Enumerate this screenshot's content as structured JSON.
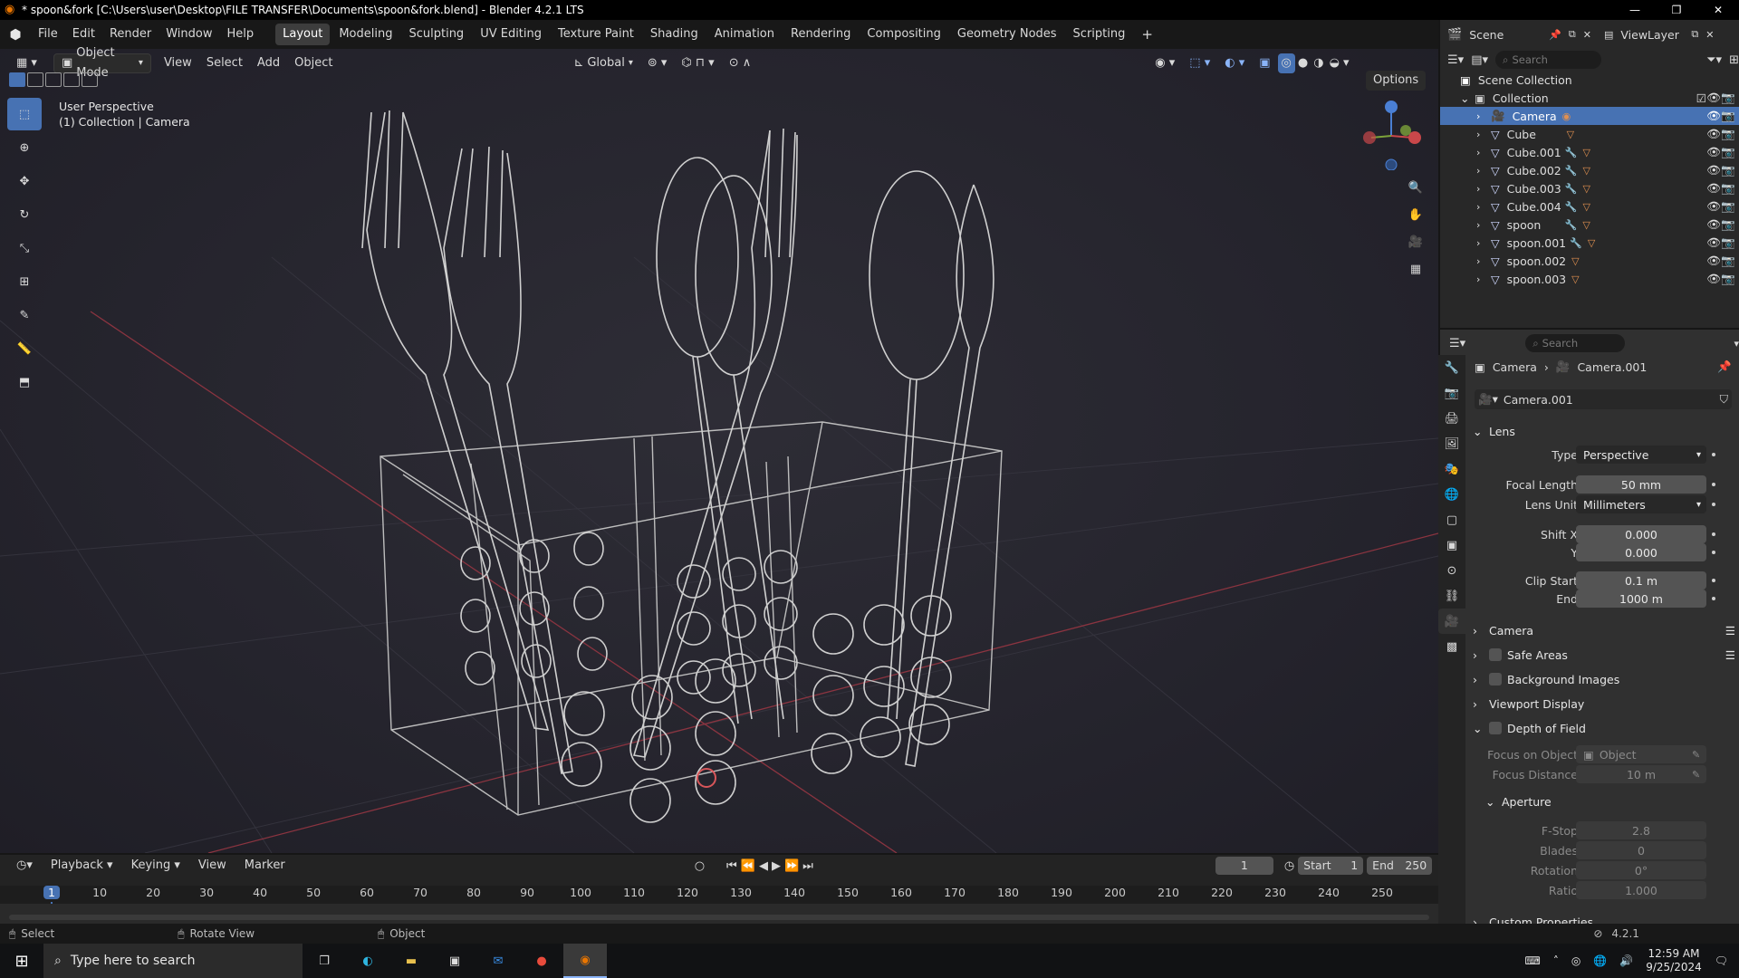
{
  "window": {
    "title": "* spoon&fork [C:\\Users\\user\\Desktop\\FILE TRANSFER\\Documents\\spoon&fork.blend] - Blender 4.2.1 LTS",
    "controls": [
      "—",
      "❐",
      "✕"
    ]
  },
  "menu": [
    "File",
    "Edit",
    "Render",
    "Window",
    "Help"
  ],
  "workspaces": [
    "Layout",
    "Modeling",
    "Sculpting",
    "UV Editing",
    "Texture Paint",
    "Shading",
    "Animation",
    "Rendering",
    "Compositing",
    "Geometry Nodes",
    "Scripting"
  ],
  "active_workspace": "Layout",
  "scene": {
    "label": "Scene",
    "view_layer": "ViewLayer"
  },
  "viewport_header": {
    "mode": "Object Mode",
    "menus": [
      "View",
      "Select",
      "Add",
      "Object"
    ],
    "orientation": "Global",
    "options": "Options"
  },
  "viewport_info": {
    "line1": "User Perspective",
    "line2": "(1) Collection | Camera"
  },
  "gizmo": {
    "x": "X",
    "y": "Y",
    "z": "Z"
  },
  "outliner": {
    "search_placeholder": "Search",
    "scene_collection": "Scene Collection",
    "collection": "Collection",
    "items": [
      {
        "name": "Camera",
        "selected": true
      },
      {
        "name": "Cube",
        "selected": false
      },
      {
        "name": "Cube.001",
        "selected": false
      },
      {
        "name": "Cube.002",
        "selected": false
      },
      {
        "name": "Cube.003",
        "selected": false
      },
      {
        "name": "Cube.004",
        "selected": false
      },
      {
        "name": "spoon",
        "selected": false
      },
      {
        "name": "spoon.001",
        "selected": false
      },
      {
        "name": "spoon.002",
        "selected": false
      },
      {
        "name": "spoon.003",
        "selected": false
      }
    ]
  },
  "properties": {
    "search_placeholder": "Search",
    "breadcrumb_object": "Camera",
    "breadcrumb_data": "Camera.001",
    "datablock": "Camera.001",
    "lens_panel": "Lens",
    "type_label": "Type",
    "type_value": "Perspective",
    "focal_label": "Focal Length",
    "focal_value": "50 mm",
    "lens_unit_label": "Lens Unit",
    "lens_unit_value": "Millimeters",
    "shift_x_label": "Shift X",
    "shift_x_value": "0.000",
    "shift_y_label": "Y",
    "shift_y_value": "0.000",
    "clip_start_label": "Clip Start",
    "clip_start_value": "0.1 m",
    "clip_end_label": "End",
    "clip_end_value": "1000 m",
    "panels": [
      "Camera",
      "Safe Areas",
      "Background Images",
      "Viewport Display",
      "Depth of Field"
    ],
    "focus_object_label": "Focus on Object",
    "focus_object_placeholder": "Object",
    "focus_distance_label": "Focus Distance",
    "focus_distance_value": "10 m",
    "aperture_panel": "Aperture",
    "fstop_label": "F-Stop",
    "fstop_value": "2.8",
    "blades_label": "Blades",
    "blades_value": "0",
    "rotation_label": "Rotation",
    "rotation_value": "0°",
    "ratio_label": "Ratio",
    "ratio_value": "1.000",
    "custom_props": "Custom Properties"
  },
  "timeline": {
    "menus": [
      "Playback",
      "Keying",
      "View",
      "Marker"
    ],
    "current_frame": "1",
    "start_label": "Start",
    "start_value": "1",
    "end_label": "End",
    "end_value": "250",
    "frames": [
      "1",
      "10",
      "20",
      "30",
      "40",
      "50",
      "60",
      "70",
      "80",
      "90",
      "100",
      "110",
      "120",
      "130",
      "140",
      "150",
      "160",
      "170",
      "180",
      "190",
      "200",
      "210",
      "220",
      "230",
      "240",
      "250"
    ]
  },
  "statusbar": {
    "select": "Select",
    "rotate": "Rotate View",
    "object": "Object",
    "version": "4.2.1"
  },
  "taskbar": {
    "search_placeholder": "Type here to search",
    "time": "12:59 AM",
    "date": "9/25/2024"
  },
  "colors": {
    "accent": "#4772b3",
    "viewport_bg": "#25242d",
    "x_axis": "#c9474a"
  }
}
